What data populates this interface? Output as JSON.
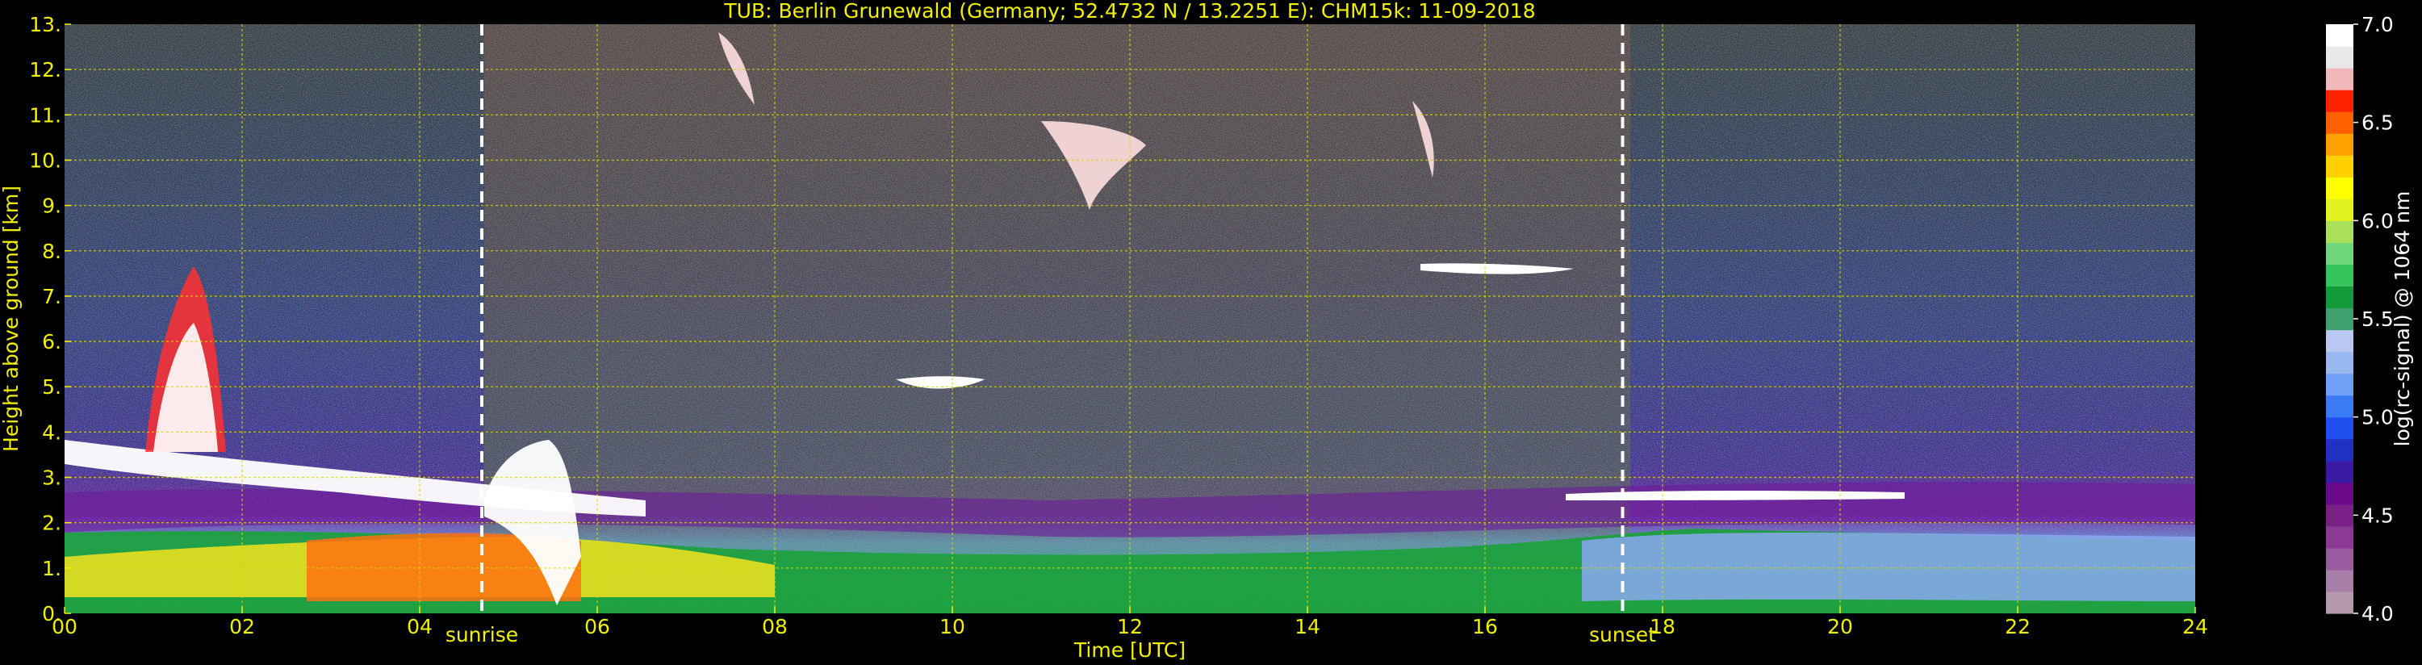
{
  "chart_data": {
    "type": "heatmap",
    "title": "TUB: Berlin Grunewald (Germany; 52.4732 N / 13.2251 E):    CHM15k: 11-09-2018",
    "xlabel": "Time [UTC]",
    "ylabel": "Height above ground [km]",
    "xlim": [
      0,
      24
    ],
    "ylim": [
      0,
      13
    ],
    "x_ticks": [
      0,
      2,
      4,
      6,
      8,
      10,
      12,
      14,
      16,
      18,
      20,
      22,
      24
    ],
    "x_tick_labels": [
      "00",
      "02",
      "04",
      "06",
      "08",
      "10",
      "12",
      "14",
      "16",
      "18",
      "20",
      "22",
      "24"
    ],
    "y_ticks": [
      0,
      1,
      2,
      3,
      4,
      5,
      6,
      7,
      8,
      9,
      10,
      11,
      12,
      13
    ],
    "y_tick_labels": [
      "0.",
      "1.",
      "2.",
      "3.",
      "4.",
      "5.",
      "6.",
      "7.",
      "8.",
      "9.",
      "10.",
      "11.",
      "12.",
      "13."
    ],
    "grid": true,
    "events": [
      {
        "label": "sunrise",
        "time": 4.7
      },
      {
        "label": "sunset",
        "time": 17.55
      }
    ],
    "colorbar": {
      "label": "log(rc-signal) @ 1064 nm",
      "range": [
        4.0,
        7.0
      ],
      "ticks": [
        4.0,
        4.5,
        5.0,
        5.5,
        6.0,
        6.5,
        7.0
      ],
      "tick_labels": [
        "4.0",
        "4.5",
        "5.0",
        "5.5",
        "6.0",
        "6.5",
        "7.0"
      ],
      "colors": [
        "#b59aae",
        "#a87fa8",
        "#9a5b9e",
        "#8a3a93",
        "#7a1f86",
        "#6a0a8a",
        "#3a1aa0",
        "#2030c0",
        "#2050f0",
        "#3a7bf5",
        "#6fa0f5",
        "#9ab8f0",
        "#b8c8f0",
        "#3fa070",
        "#129a3a",
        "#35c35a",
        "#6fd67a",
        "#a8e05a",
        "#e0f020",
        "#ffff00",
        "#ffd000",
        "#ffa000",
        "#ff6000",
        "#ff2000",
        "#f0b8b8",
        "#e8e8e8",
        "#ffffff"
      ]
    },
    "layers": [
      {
        "kind": "background",
        "color": "#000"
      },
      {
        "kind": "band",
        "name": "boundary-layer",
        "x_range": [
          0,
          24
        ],
        "color": "#20a040"
      }
    ]
  }
}
